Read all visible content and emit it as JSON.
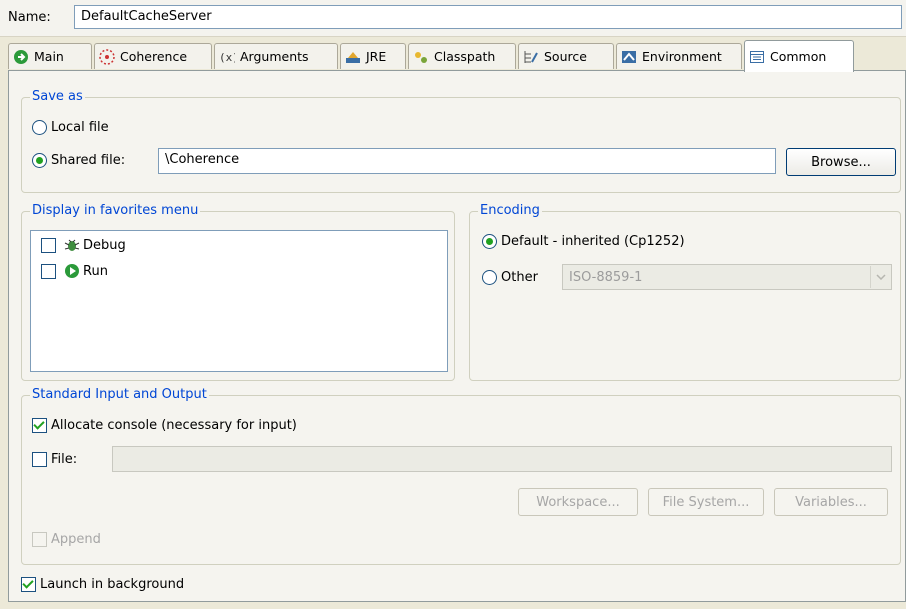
{
  "name_row": {
    "label": "Name:",
    "value": "DefaultCacheServer"
  },
  "tabs": [
    {
      "label": "Main",
      "icon": "main-icon"
    },
    {
      "label": "Coherence",
      "icon": "coherence-icon"
    },
    {
      "label": "Arguments",
      "icon": "arguments-icon"
    },
    {
      "label": "JRE",
      "icon": "jre-icon"
    },
    {
      "label": "Classpath",
      "icon": "classpath-icon"
    },
    {
      "label": "Source",
      "icon": "source-icon"
    },
    {
      "label": "Environment",
      "icon": "environment-icon"
    },
    {
      "label": "Common",
      "icon": "common-icon",
      "active": true
    }
  ],
  "save_as": {
    "title": "Save as",
    "local_label": "Local file",
    "shared_label": "Shared file:",
    "shared_value": "\\Coherence",
    "browse_label": "Browse...",
    "selected": "shared"
  },
  "favorites": {
    "title": "Display in favorites menu",
    "items": [
      {
        "label": "Debug",
        "icon": "debug-icon",
        "checked": false
      },
      {
        "label": "Run",
        "icon": "run-icon",
        "checked": false
      }
    ]
  },
  "encoding": {
    "title": "Encoding",
    "default_label": "Default - inherited (Cp1252)",
    "other_label": "Other",
    "other_value": "ISO-8859-1",
    "selected": "default"
  },
  "std_io": {
    "title": "Standard Input and Output",
    "allocate_label": "Allocate console (necessary for input)",
    "allocate_checked": true,
    "file_label": "File:",
    "file_checked": false,
    "file_value": "",
    "workspace_label": "Workspace...",
    "filesystem_label": "File System...",
    "variables_label": "Variables...",
    "append_label": "Append",
    "append_checked": false
  },
  "launch_bg": {
    "label": "Launch in background",
    "checked": true
  },
  "colors": {
    "group_title": "#0046d5",
    "radio_dot": "#21a121",
    "check_mark": "#21a121"
  }
}
